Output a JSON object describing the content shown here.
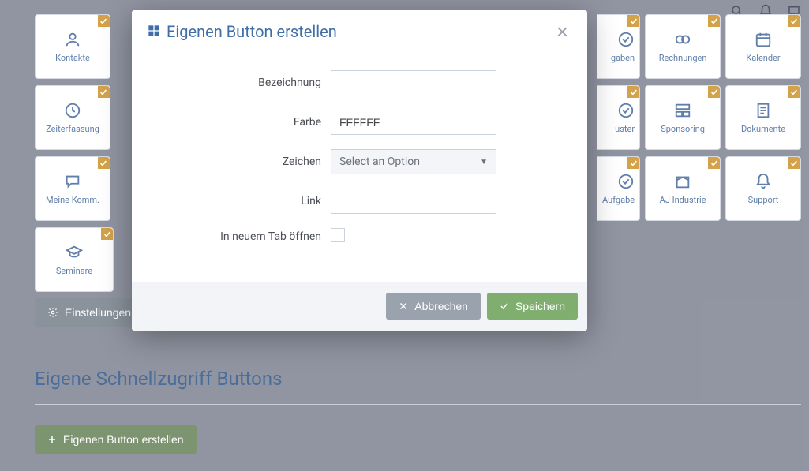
{
  "header_icons": [
    "search-icon",
    "bell-icon",
    "chat-icon"
  ],
  "tiles": [
    {
      "label": "Kontakte",
      "icon": "person"
    },
    {
      "label": "",
      "icon": "",
      "hidden": true
    },
    {
      "label": "",
      "icon": "",
      "hidden": true
    },
    {
      "label": "",
      "icon": "",
      "hidden": true
    },
    {
      "label": "",
      "icon": "",
      "hidden": true
    },
    {
      "label": "",
      "icon": "",
      "hidden": true
    },
    {
      "label": "",
      "icon": "",
      "hidden": true
    },
    {
      "label": "",
      "icon": "",
      "partial": true,
      "partial_label": "gaben"
    },
    {
      "label": "Rechnungen",
      "icon": "eye"
    },
    {
      "label": "Kalender",
      "icon": "calendar"
    },
    {
      "label": "Zeiterfassung",
      "icon": "clock"
    },
    {
      "label": "",
      "icon": "",
      "hidden": true
    },
    {
      "label": "",
      "icon": "",
      "hidden": true
    },
    {
      "label": "",
      "icon": "",
      "hidden": true
    },
    {
      "label": "",
      "icon": "",
      "hidden": true
    },
    {
      "label": "",
      "icon": "",
      "hidden": true
    },
    {
      "label": "",
      "icon": "",
      "hidden": true
    },
    {
      "label": "",
      "icon": "",
      "partial": true,
      "partial_label": "uster"
    },
    {
      "label": "Sponsoring",
      "icon": "layout"
    },
    {
      "label": "Dokumente",
      "icon": "doc"
    },
    {
      "label": "Meine Komm.",
      "icon": "chat"
    },
    {
      "label": "",
      "icon": "",
      "hidden": true
    },
    {
      "label": "",
      "icon": "",
      "hidden": true
    },
    {
      "label": "",
      "icon": "",
      "hidden": true
    },
    {
      "label": "",
      "icon": "",
      "hidden": true
    },
    {
      "label": "",
      "icon": "",
      "hidden": true
    },
    {
      "label": "",
      "icon": "",
      "hidden": true
    },
    {
      "label": "",
      "icon": "",
      "partial": true,
      "partial_label": "Aufgabe"
    },
    {
      "label": "AJ Industrie",
      "icon": "box"
    },
    {
      "label": "Support",
      "icon": "bell"
    },
    {
      "label": "Seminare",
      "icon": "grad"
    }
  ],
  "settings_btn": "Einstellungen",
  "section_title": "Eigene Schnellzugriff Buttons",
  "create_btn": "Eigenen Button erstellen",
  "modal": {
    "title": "Eigenen Button erstellen",
    "fields": {
      "bezeichnung": {
        "label": "Bezeichnung",
        "value": ""
      },
      "farbe": {
        "label": "Farbe",
        "value": "FFFFFF"
      },
      "zeichen": {
        "label": "Zeichen",
        "placeholder": "Select an Option"
      },
      "link": {
        "label": "Link",
        "value": ""
      },
      "newtab": {
        "label": "In neuem Tab öffnen",
        "checked": false
      }
    },
    "cancel": "Abbrechen",
    "save": "Speichern"
  }
}
